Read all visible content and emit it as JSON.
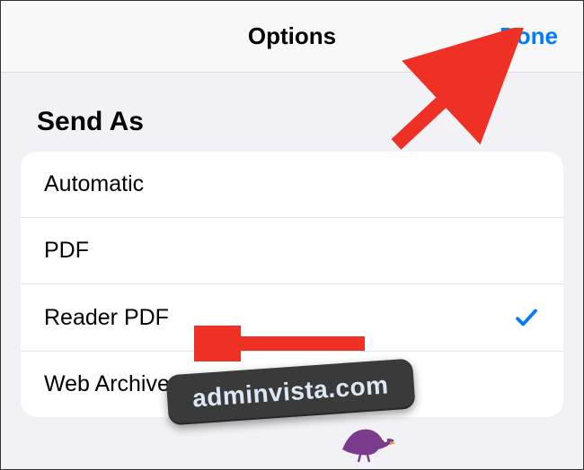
{
  "header": {
    "title": "Options",
    "done_label": "Done"
  },
  "section": {
    "header": "Send As",
    "items": [
      {
        "label": "Automatic",
        "checked": false
      },
      {
        "label": "PDF",
        "checked": false
      },
      {
        "label": "Reader PDF",
        "checked": true
      },
      {
        "label": "Web Archive",
        "checked": false
      }
    ]
  },
  "watermark": {
    "text": "adminvista.com"
  },
  "annotation": {
    "arrow_color": "#ef3125"
  }
}
